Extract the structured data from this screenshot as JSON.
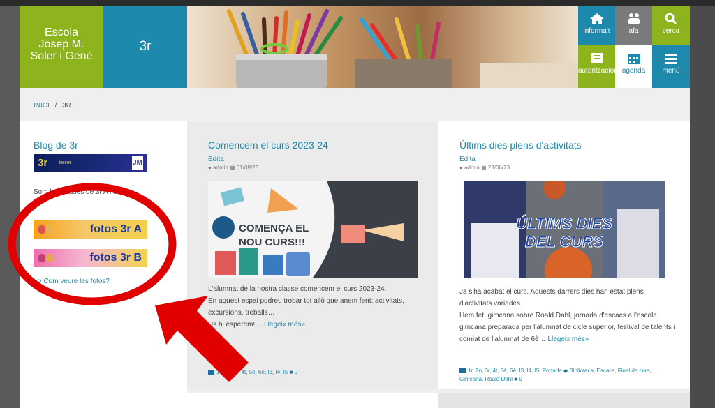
{
  "header": {
    "school_name": "Escola Josep M. Soler i Gené",
    "class_name": "3r",
    "nav": [
      {
        "label": "informa't",
        "icon": "home-icon",
        "color": "#1d8aad"
      },
      {
        "label": "afa",
        "icon": "people-icon",
        "color": "#7a7a7a"
      },
      {
        "label": "cerca",
        "icon": "search-icon",
        "color": "#8db31d"
      },
      {
        "label": "autoritzacions",
        "icon": "form-icon",
        "color": "#8db31d"
      },
      {
        "label": "agenda",
        "icon": "calendar-icon",
        "color": "#ffffff"
      },
      {
        "label": "menú",
        "icon": "menu-icon",
        "color": "#1d8aad"
      }
    ]
  },
  "breadcrumb": {
    "home": "INICI",
    "separator": "/",
    "current": "3R"
  },
  "sidebar": {
    "title": "Blog de 3r",
    "banner_text": "3r",
    "banner_small": "tercer",
    "intro": "Som les classes de 3r A i 3r B.",
    "photo_a": "fotos 3r A",
    "photo_b": "fotos 3r B",
    "help_link": ">> Com veure les fotos?"
  },
  "posts": [
    {
      "title": "Comencem el curs 2023-24",
      "edit": "Edita",
      "author": "admin",
      "date": "01/09/23",
      "image_text_1": "COMENÇA EL",
      "image_text_2": "NOU CURS!!!",
      "body_1": "L'alumnat de la nostra classe comencem el curs 2023-24.",
      "body_2": "En aquest espai podreu trobar tot allò que anem fent: activitats, excursions, treballs…",
      "body_3": "Us hi esperem!… ",
      "more": "Llegeix més»",
      "tags": "1r, 2n, 3r, 4t, 5è, 6è, I3, I4, I5",
      "comments": "0"
    },
    {
      "title": "Últims dies plens d'activitats",
      "edit": "Edita",
      "author": "admin",
      "date": "23/06/23",
      "image_text_1": "ÚLTIMS DIES",
      "image_text_2": "DEL CURS",
      "body_1": "Ja s'ha acabat el curs. Aquests darrers dies han estat plens d'activitats variades.",
      "body_2": "Hem fet: gimcana sobre Roald Dahl, jornada d'escacs a l'escola, gimcana preparada per l'alumnat de cicle superior, festival de talents i comiat de l'alumnat de 6è… ",
      "more": "Llegeix més»",
      "tags": "1r, 2n, 3r, 4t, 5è, 6è, I3, I4, I5, Portada",
      "tags2": "Biblioteca, Escacs, Final de curs, Gimcana, Roald Dahl",
      "comments": "0"
    }
  ],
  "colors": {
    "green": "#8db31d",
    "blue": "#1d8aad",
    "annotation_red": "#e00000"
  }
}
